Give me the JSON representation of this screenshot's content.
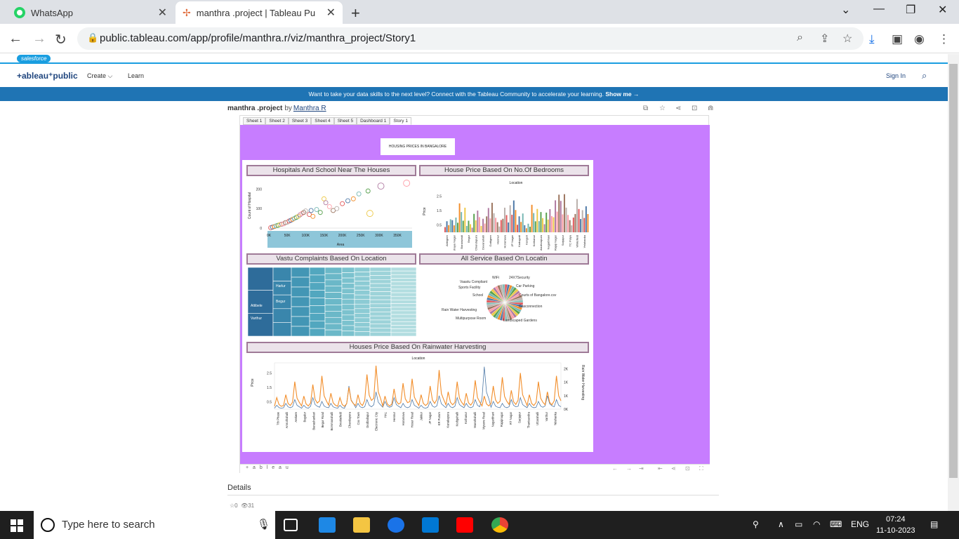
{
  "browser": {
    "tabs": [
      {
        "title": "WhatsApp"
      },
      {
        "title": "manthra .project | Tableau Public"
      }
    ],
    "url": "public.tableau.com/app/profile/manthra.r/viz/manthra_project/Story1"
  },
  "site": {
    "salesforce_label": "salesforce",
    "logo": "+ableau⁺public",
    "nav": [
      "Create",
      "Learn"
    ],
    "sign_in": "Sign In",
    "banner_text": "Want to take your data skills to the next level? Connect with the Tableau Community to accelerate your learning.",
    "banner_link": "Show me →"
  },
  "viz": {
    "project": "manthra .project",
    "by": "by",
    "author": "Manthra R",
    "sheet_tabs": [
      "Sheet 1",
      "Sheet 2",
      "Sheet 3",
      "Sheet 4",
      "Sheet 5",
      "Dashboard 1",
      "Story 1"
    ],
    "story_title": "HOUSING PRICES IN BANGALORE",
    "footer_logo": "+ a b l e a u",
    "widgets": {
      "w1": "Hospitals And School Near The Houses",
      "w2": "House Price Based On No.Of Bedrooms",
      "w3": "Vastu Complaints Based On Location",
      "w4": "All Service Based On Locatin",
      "w5": "Houses Price Based On Rainwater Harvesting"
    }
  },
  "chart_data": [
    {
      "type": "scatter",
      "xlabel": "Area",
      "ylabel": "Count of Hospital",
      "x_ticks": [
        "0K",
        "50K",
        "100K",
        "150K",
        "200K",
        "250K",
        "300K",
        "350K"
      ],
      "y_ticks": [
        "0",
        "100",
        "200"
      ],
      "points": [
        {
          "x": 5,
          "y": 2
        },
        {
          "x": 10,
          "y": 5
        },
        {
          "x": 15,
          "y": 8
        },
        {
          "x": 20,
          "y": 12
        },
        {
          "x": 25,
          "y": 14
        },
        {
          "x": 30,
          "y": 18
        },
        {
          "x": 35,
          "y": 20
        },
        {
          "x": 40,
          "y": 22
        },
        {
          "x": 45,
          "y": 28
        },
        {
          "x": 50,
          "y": 30
        },
        {
          "x": 55,
          "y": 36
        },
        {
          "x": 60,
          "y": 40
        },
        {
          "x": 65,
          "y": 45
        },
        {
          "x": 70,
          "y": 50
        },
        {
          "x": 75,
          "y": 55
        },
        {
          "x": 80,
          "y": 60
        },
        {
          "x": 85,
          "y": 68
        },
        {
          "x": 90,
          "y": 75
        },
        {
          "x": 95,
          "y": 80
        },
        {
          "x": 100,
          "y": 88
        },
        {
          "x": 110,
          "y": 70
        },
        {
          "x": 115,
          "y": 90
        },
        {
          "x": 120,
          "y": 60
        },
        {
          "x": 130,
          "y": 95
        },
        {
          "x": 140,
          "y": 80
        },
        {
          "x": 150,
          "y": 150
        },
        {
          "x": 155,
          "y": 130
        },
        {
          "x": 165,
          "y": 110
        },
        {
          "x": 175,
          "y": 90
        },
        {
          "x": 185,
          "y": 100
        },
        {
          "x": 200,
          "y": 125
        },
        {
          "x": 215,
          "y": 140
        },
        {
          "x": 230,
          "y": 150
        },
        {
          "x": 245,
          "y": 175
        },
        {
          "x": 270,
          "y": 190
        },
        {
          "x": 275,
          "y": 75
        },
        {
          "x": 305,
          "y": 215
        },
        {
          "x": 375,
          "y": 230
        }
      ],
      "xlim": [
        0,
        390
      ],
      "ylim": [
        0,
        230
      ]
    },
    {
      "type": "bar",
      "title": "Location",
      "ylabel": "Price",
      "y_ticks": [
        "0.5",
        "1.5",
        "2.5"
      ],
      "categories": [
        "Abbigere",
        "Akshaya Nagar",
        "Banaswadi",
        "Begur",
        "Chandapura",
        "Devanahalli",
        "Gottigere",
        "Hennur",
        "Horamavu",
        "JP Nagar",
        "Kadugodi",
        "Kengeri",
        "Kothanur",
        "Mahadevapura",
        "Nagarbhavi",
        "Rajaji Nagar",
        "Sarjapur",
        "TC Palya",
        "Whitefield",
        "Yelahanka"
      ],
      "values": [
        0.9,
        1.2,
        2.0,
        0.8,
        1.5,
        1.1,
        2.4,
        1.0,
        1.7,
        2.2,
        1.3,
        0.7,
        1.9,
        1.4,
        1.6,
        2.6,
        3.1,
        1.2,
        2.3,
        1.8
      ],
      "ylim": [
        0,
        3.2
      ]
    },
    {
      "type": "heatmap",
      "title": "Vastu Complaints Based On Location",
      "labels": [
        "Harlur",
        "Begur",
        "Attibele",
        "Varthur"
      ]
    },
    {
      "type": "pie",
      "labels": [
        "Vaastu Compliant",
        "WiFi",
        "24X7Security",
        "Car Parking",
        "Sports Facility",
        "School",
        "Courts of Bangalore.csv",
        "Gasconnection",
        "Rain Water Harvesting",
        "Multipurpose Room",
        "Landscaped Gardens"
      ],
      "values": [
        1,
        1,
        1,
        1,
        1,
        1,
        1,
        1,
        1,
        1,
        1
      ]
    },
    {
      "type": "line",
      "title": "Location",
      "ylabel": "Price",
      "y2label": "Rain Water Harvesting",
      "y_ticks": [
        "0.5",
        "1.5",
        "2.5"
      ],
      "y2_ticks": [
        "0K",
        "1K",
        "1K",
        "2K"
      ],
      "categories": [
        "7th Phase",
        "Amruthahalli",
        "Arekere",
        "Bagalur",
        "Banashankari",
        "Begur Road",
        "Bommanahalli",
        "Brookefield",
        "Chandapura",
        "Cox Town",
        "Dodballapur",
        "Electronic City",
        "HAL",
        "Hennur",
        "Horamavu",
        "Hosur Road",
        "Jakkur",
        "JP Nagar",
        "KR Puram",
        "Kanakapura",
        "Kodigehalli",
        "Kothanur",
        "Marathahalli",
        "Mysore Road",
        "Nagarbhavi",
        "Rajajinagar",
        "RT Nagar",
        "Sarjapur",
        "Thanisandra",
        "Uttarahalli",
        "Varthur",
        "Yelahanka"
      ],
      "series": [
        {
          "name": "Price",
          "values": [
            0.8,
            1.0,
            1.9,
            0.9,
            1.7,
            2.3,
            1.1,
            0.8,
            1.5,
            1.0,
            2.4,
            3.0,
            0.9,
            1.4,
            1.8,
            2.1,
            1.0,
            1.6,
            2.7,
            1.2,
            1.9,
            1.1,
            2.0,
            0.9,
            1.6,
            2.2,
            1.3,
            2.5,
            1.0,
            1.9,
            1.2,
            2.3
          ]
        },
        {
          "name": "Rain Water Harvesting",
          "values": [
            200,
            300,
            500,
            200,
            600,
            400,
            300,
            200,
            1200,
            300,
            500,
            900,
            400,
            600,
            300,
            500,
            200,
            400,
            700,
            300,
            600,
            300,
            500,
            2200,
            400,
            300,
            500,
            600,
            300,
            400,
            700,
            500
          ]
        }
      ]
    }
  ],
  "page": {
    "details": "Details",
    "favorites": "0",
    "views": "31"
  },
  "taskbar": {
    "search_placeholder": "Type here to search",
    "lang": "ENG",
    "time": "07:24",
    "date": "11-10-2023"
  }
}
